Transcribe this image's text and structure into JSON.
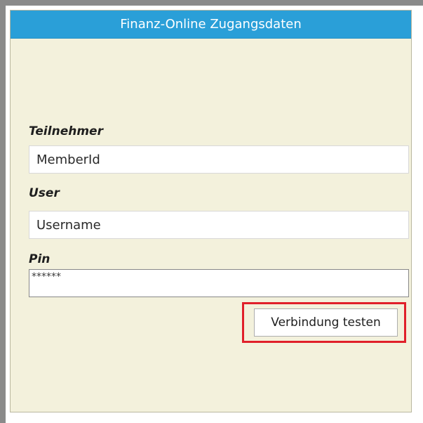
{
  "window": {
    "title": "Finanz-Online Zugangsdaten",
    "accent_color": "#2a9fd8",
    "panel_color": "#f3f1dc",
    "highlight_color": "#e0202a"
  },
  "form": {
    "teilnehmer": {
      "label": "Teilnehmer",
      "value": "MemberId"
    },
    "user": {
      "label": "User",
      "value": "Username"
    },
    "pin": {
      "label": "Pin",
      "value": "******"
    },
    "test_button_label": "Verbindung testen"
  }
}
